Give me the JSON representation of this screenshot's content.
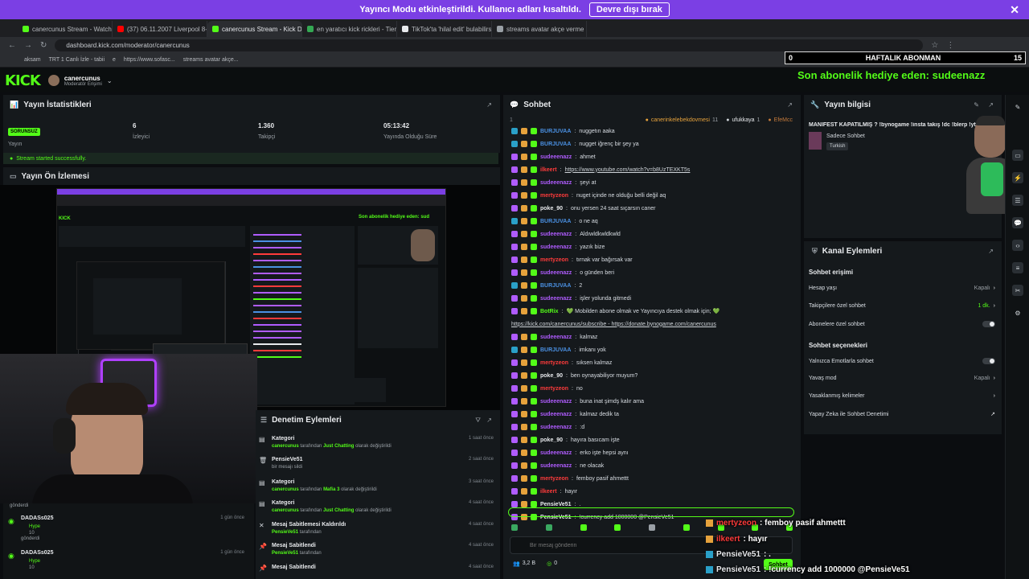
{
  "banner": {
    "text": "Yayıncı Modu etkinleştirildi. Kullanıcı adları kısaltıldı.",
    "button": "Devre dışı bırak"
  },
  "browser": {
    "tabs": [
      {
        "label": "canercunus Stream - Watch Liv",
        "color": "#53fc18"
      },
      {
        "label": "(37) 06.11.2007 Liverpool 8-0 B",
        "color": "#ff0000"
      },
      {
        "label": "canercunus Stream - Kick Dash",
        "color": "#53fc18"
      },
      {
        "label": "en yaratıcı kick rickleri - Tier Lis",
        "color": "#34a853"
      },
      {
        "label": "TikTok'ta 'hilal edit' bulabilirsin",
        "color": "#e8eaed"
      },
      {
        "label": "streams avatar akçe verme kon",
        "color": "#9aa0a6"
      }
    ],
    "url": "dashboard.kick.com/moderator/canercunus",
    "bookmarks": [
      "aksam",
      "TRT 1 Canlı İzle - tabii",
      "e",
      "https://www.sofasc...",
      "streams avatar akçe..."
    ],
    "all_bookmarks": "Tüm Yer İşaretl..."
  },
  "overlay": {
    "sub_bar": {
      "left": "0",
      "title": "HAFTALIK ABONMAN",
      "right": "15"
    },
    "last_sub": "Son abonelik hediye eden: sudeenazz"
  },
  "header": {
    "logo": "KICK",
    "username": "canercunus",
    "role": "Moderatör Erişimi"
  },
  "stats": {
    "title": "Yayın İstatistikleri",
    "status_badge": "SORUNSUZ",
    "items": [
      {
        "value": "",
        "label": "Yayın"
      },
      {
        "value": "6",
        "label": "İzleyici"
      },
      {
        "value": "1.360",
        "label": "Takipçi"
      },
      {
        "value": "05:13:42",
        "label": "Yayında Olduğu Süre"
      }
    ],
    "stream_ok": "Stream started successfully."
  },
  "preview": {
    "title": "Yayın Ön İzlemesi",
    "inner_sub_text": "Son abonelik hediye eden: sud"
  },
  "recent": [
    {
      "name": "gönderdi",
      "sub": ""
    },
    {
      "name": "DADASs025",
      "badge": "Hype",
      "count": "10",
      "action": "gönderdi",
      "time": "1 gün önce"
    },
    {
      "name": "DADASs025",
      "badge": "Hype",
      "count": "10",
      "action": "",
      "time": "1 gün önce"
    }
  ],
  "moderation": {
    "title": "Denetim Eylemleri",
    "rows": [
      {
        "icon": "category-icon",
        "title": "Kategori",
        "user": "canercunus",
        "mid": "tarafından",
        "target": "Just Chatting",
        "end": "olarak değiştirildi",
        "time": "1 saat önce"
      },
      {
        "icon": "trash-icon",
        "title": "PensieVe51",
        "user": "",
        "mid": "bir mesajı sildi",
        "target": "",
        "end": "",
        "time": "2 saat önce"
      },
      {
        "icon": "category-icon",
        "title": "Kategori",
        "user": "canercunus",
        "mid": "tarafından",
        "target": "Mafia 3",
        "end": "olarak değiştirildi",
        "time": "3 saat önce"
      },
      {
        "icon": "category-icon",
        "title": "Kategori",
        "user": "canercunus",
        "mid": "tarafından",
        "target": "Just Chatting",
        "end": "olarak değiştirildi",
        "time": "4 saat önce"
      },
      {
        "icon": "unpin-icon",
        "title": "Mesaj Sabitlemesi Kaldırıldı",
        "user": "PensieVe51",
        "mid": "tarafından",
        "target": "",
        "end": "",
        "time": "4 saat önce"
      },
      {
        "icon": "pin-icon",
        "title": "Mesaj Sabitlendi",
        "user": "PensieVe51",
        "mid": "tarafından",
        "target": "",
        "end": "",
        "time": "4 saat önce"
      },
      {
        "icon": "pin-icon",
        "title": "Mesaj Sabitlendi",
        "user": "",
        "mid": "",
        "target": "",
        "end": "",
        "time": "4 saat önce"
      }
    ]
  },
  "chat": {
    "title": "Sohbet",
    "top_users": [
      {
        "name": "canerinkelebekdovmesi",
        "n": "11"
      },
      {
        "name": "ufukkaya",
        "n": "1"
      },
      {
        "name": "EfeMcc",
        "n": ""
      }
    ],
    "messages": [
      {
        "user": "BURJUVAA",
        "color": "#4a90e2",
        "text": "nuggetın aaka"
      },
      {
        "user": "BURJUVAA",
        "color": "#4a90e2",
        "text": "nugget iğrenç bir şey ya"
      },
      {
        "user": "sudeeenazz",
        "color": "#b05cff",
        "text": "ahmet"
      },
      {
        "user": "ilkeert",
        "color": "#ff3b3b",
        "text": "https://www.youtube.com/watch?v=b8UzTEXKT5s",
        "link": true
      },
      {
        "user": "sudeeenazz",
        "color": "#b05cff",
        "text": "şeyi at"
      },
      {
        "user": "mertyzeon",
        "color": "#ff3b3b",
        "text": "nuget içinde ne olduğu belli değil aq"
      },
      {
        "user": "poke_90",
        "color": "#e8eaed",
        "text": "onu yersen 24 saat sıçarsın caner"
      },
      {
        "user": "BURJUVAA",
        "color": "#4a90e2",
        "text": "o ne aq"
      },
      {
        "user": "sudeeenazz",
        "color": "#b05cff",
        "text": "Aldıwldkwldkwld"
      },
      {
        "user": "sudeeenazz",
        "color": "#b05cff",
        "text": "yazık bize"
      },
      {
        "user": "mertyzeon",
        "color": "#ff3b3b",
        "text": "tırnak var bağırsak var"
      },
      {
        "user": "sudeeenazz",
        "color": "#b05cff",
        "text": "o günden beri"
      },
      {
        "user": "BURJUVAA",
        "color": "#4a90e2",
        "text": "2"
      },
      {
        "user": "sudeeenazz",
        "color": "#b05cff",
        "text": "işler yolunda gitmedi"
      },
      {
        "user": "BotRix",
        "color": "#53fc18",
        "text": "💚 Mobilden abone olmak ve Yayıncıya destek olmak için; 💚"
      },
      {
        "user": "",
        "color": "#53fc18",
        "text": "https://kick.com/canercunus/subscribe - https://donate.bynogame.com/canercunus",
        "link": true
      },
      {
        "user": "sudeeenazz",
        "color": "#b05cff",
        "text": "kalmaz"
      },
      {
        "user": "BURJUVAA",
        "color": "#4a90e2",
        "text": "imkanı yok"
      },
      {
        "user": "mertyzeon",
        "color": "#ff3b3b",
        "text": "sıksen kalmaz"
      },
      {
        "user": "poke_90",
        "color": "#e8eaed",
        "text": "ben oynayabiliyor muyum?"
      },
      {
        "user": "mertyzeon",
        "color": "#ff3b3b",
        "text": "no"
      },
      {
        "user": "sudeeenazz",
        "color": "#b05cff",
        "text": "buna inat şimdş kalır ama"
      },
      {
        "user": "sudeeenazz",
        "color": "#b05cff",
        "text": "kalmaz dedik ta"
      },
      {
        "user": "sudeeenazz",
        "color": "#b05cff",
        "text": ":d"
      },
      {
        "user": "poke_90",
        "color": "#e8eaed",
        "text": "hayıra basıcam işte"
      },
      {
        "user": "sudeeenazz",
        "color": "#b05cff",
        "text": "erko işte hepsi aynı"
      },
      {
        "user": "sudeeenazz",
        "color": "#b05cff",
        "text": "ne olacak"
      },
      {
        "user": "mertyzeon",
        "color": "#ff3b3b",
        "text": "femboy pasif ahmettt"
      },
      {
        "user": "ilkeert",
        "color": "#ff3b3b",
        "text": "hayır"
      },
      {
        "user": "PensieVe51",
        "color": "#e8eaed",
        "text": "."
      },
      {
        "user": "PensieVe51",
        "color": "#e8eaed",
        "text": "!currency add 1000000 @PensieVe51"
      }
    ],
    "placeholder": "Bir mesaj gönderin",
    "viewers": "3,2 B",
    "points": "0",
    "send": "Sohbet"
  },
  "stream_info": {
    "title": "Yayın bilgisi",
    "stream_title": "MANİFEST KAPATILMIŞ ? !bynogame !insta takış !dc !blerp !yt",
    "category": "Sadece Sohbet",
    "tag": "Turkish"
  },
  "channel_actions": {
    "title": "Kanal Eylemleri",
    "chat_access": "Sohbet erişimi",
    "rows1": [
      {
        "label": "Hesap yaşı",
        "value": "Kapalı",
        "type": "chevron"
      },
      {
        "label": "Takipçilere özel sohbet",
        "value": "1 dk.",
        "type": "chevron"
      },
      {
        "label": "Abonelere özel sohbet",
        "value": "",
        "type": "toggle"
      }
    ],
    "chat_options": "Sohbet seçenekleri",
    "rows2": [
      {
        "label": "Yalnızca Emotlarla sohbet",
        "value": "",
        "type": "toggle"
      },
      {
        "label": "Yavaş mod",
        "value": "Kapalı",
        "type": "chevron"
      },
      {
        "label": "Yasaklanmış kelimeler",
        "value": "",
        "type": "chevron"
      },
      {
        "label": "Yapay Zeka ile Sohbet Denetimi",
        "value": "",
        "type": "external"
      }
    ]
  },
  "overlay_chat": [
    {
      "user": "mertyzeon",
      "color": "#ff3b3b",
      "text": ": femboy pasif ahmettt"
    },
    {
      "user": "ilkeert",
      "color": "#ff3b3b",
      "text": ": hayır"
    },
    {
      "user": "PensieVe51",
      "color": "#e8eaed",
      "text": ": ."
    },
    {
      "user": "PensieVe51",
      "color": "#e8eaed",
      "text": ": !currency add 1000000 @PensieVe51"
    }
  ],
  "colors": {
    "kick_green": "#53fc18",
    "banner": "#7b3fe4",
    "panel": "#15191c"
  }
}
